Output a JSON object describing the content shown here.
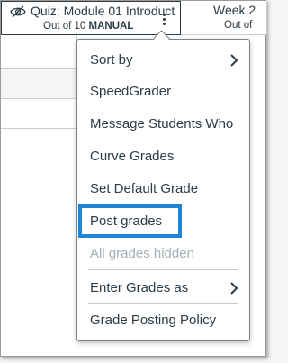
{
  "columns": [
    {
      "title": "Quiz: Module 01 Introduct",
      "subtitle_prefix": "Out of 10",
      "subtitle_tag": "MANUAL"
    },
    {
      "title": "Week 2",
      "subtitle_prefix": "Out of",
      "subtitle_tag": ""
    }
  ],
  "menu": {
    "items": [
      {
        "label": "Sort by",
        "has_submenu": true,
        "enabled": true
      },
      {
        "label": "SpeedGrader",
        "has_submenu": false,
        "enabled": true
      },
      {
        "label": "Message Students Who",
        "has_submenu": false,
        "enabled": true
      },
      {
        "label": "Curve Grades",
        "has_submenu": false,
        "enabled": true
      },
      {
        "label": "Set Default Grade",
        "has_submenu": false,
        "enabled": true
      },
      {
        "label": "Post grades",
        "has_submenu": false,
        "enabled": true,
        "highlighted": true
      },
      {
        "label": "All grades hidden",
        "has_submenu": false,
        "enabled": false
      },
      {
        "label": "Enter Grades as",
        "has_submenu": true,
        "enabled": true
      },
      {
        "label": "Grade Posting Policy",
        "has_submenu": false,
        "enabled": true
      }
    ]
  },
  "colors": {
    "text": "#2d3b45",
    "disabled_text": "#a5afb5",
    "highlight_border": "#1e86d6"
  },
  "icons": {
    "column_visibility": "eye-off-icon",
    "column_options": "kebab-menu-icon",
    "submenu": "chevron-right-icon"
  }
}
